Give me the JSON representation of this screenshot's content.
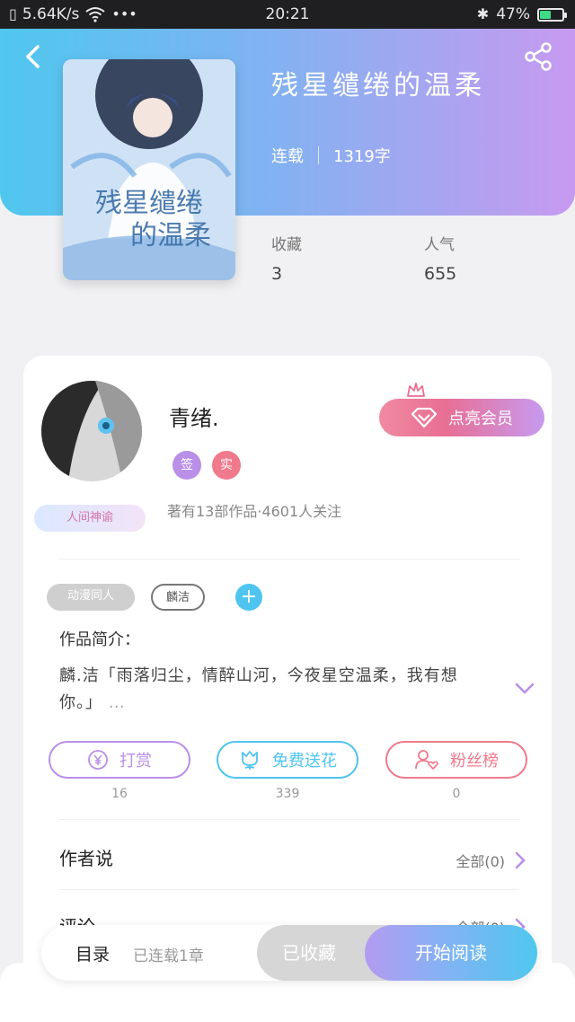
{
  "status_bar": {
    "left_text": "5.64K/s",
    "time": "20:21",
    "battery": "47%",
    "battery_level": 0.47,
    "icons": [
      "sim-icon",
      "wifi-icon",
      "more-dots-icon",
      "bluetooth-icon",
      "battery-icon"
    ]
  },
  "header": {
    "back_icon": "back-arrow-icon",
    "share_icon": "share-icon",
    "gradient_colors": [
      "#4fc7ee",
      "#7fb3f1",
      "#c79af0"
    ]
  },
  "book": {
    "title": "残星缱绻的温柔",
    "status": "连载",
    "word_count": "1319字",
    "favorites_label": "收藏",
    "favorites_value": "3",
    "popularity_label": "人气",
    "popularity_value": "655"
  },
  "author": {
    "name": "青绪.",
    "badges": [
      "签",
      "实"
    ],
    "badge_colors": [
      "#b98fe8",
      "#f07a8c"
    ],
    "hanging_badge": "人间神谕",
    "info": "著有13部作品·4601人关注",
    "vip_button": "点亮会员"
  },
  "tags": [
    "动漫同人",
    "麟洁"
  ],
  "intro": {
    "label": "作品简介：",
    "text": "麟.洁「雨落归尘，情醉山河，今夜星空温柔，我有想你。」",
    "more": "…"
  },
  "actions": [
    {
      "label": "打赏",
      "count": "16",
      "color": "#b98fe8"
    },
    {
      "label": "免费送花",
      "count": "339",
      "color": "#4fc4ef"
    },
    {
      "label": "粉丝榜",
      "count": "0",
      "color": "#f07a8c"
    }
  ],
  "sections": {
    "author_says": "作者说",
    "author_says_right": "全部(0)",
    "comments": "评论",
    "comments_right": "全部(0)"
  },
  "bottom_bar": {
    "catalog": "目录",
    "status": "已连载1章",
    "collected": "已收藏",
    "start_reading": "开始阅读"
  }
}
